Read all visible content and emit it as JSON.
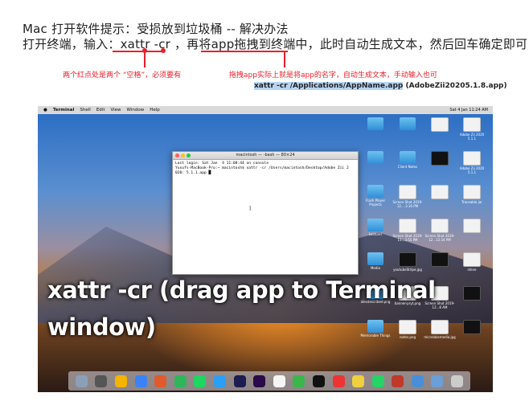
{
  "header": {
    "line1": "Mac 打开软件提示：受损放到垃圾桶 -- 解决办法",
    "line2_prefix": "打开终端，输入：",
    "line2_cmd": "xattr -cr ",
    "line2_mid": "，再将",
    "line2_drag": "app拖拽到终端中",
    "line2_suffix": "，此时自动生成文本，然后回车确定即可；"
  },
  "notes": {
    "left": "两个红点处是两个 “空格”，必须要有",
    "right": "拖拽app实际上就是将app的名字，自动生成文本，手动输入也可"
  },
  "path_example": {
    "selected": "xattr -cr /Applications/AppName.app",
    "rest": " (AdobeZii20205.1.8.app)"
  },
  "screenshot": {
    "menubar": {
      "apple": "",
      "app": "Terminal",
      "items": [
        "Shell",
        "Edit",
        "View",
        "Window",
        "Help"
      ],
      "clock": "Sat 4 Jan  11:24 AM"
    },
    "terminal": {
      "title": "macintosh — -bash — 80×24",
      "lines": [
        "Last login: Sat Jan  4 11:08:44 on console",
        "Yusufs-MacBook-Pro:~ macintosh$ xattr -cr /Users/macintosh/Desktop/Adobe Zii 2",
        "020: 5.1.1.app █"
      ]
    },
    "caption_line1": "xattr -cr (drag app to Terminal",
    "caption_line2": "window)",
    "desktop_icons": [
      "",
      "",
      "",
      "Adobe Zii 2020 5.1.1",
      "",
      "Client Notes",
      "",
      "Adobe Zii 2020 5.1.1",
      "Flash Player Projects",
      "Screen Shot 2019-12....3.16 PM",
      "",
      "Traceable jar",
      "Lecturer",
      "Screen Shot 2019-11...3.55 PM",
      "Screen Shot 2019-12...12.54 PM",
      "",
      "Media",
      "youtubeStripe.jpg",
      "",
      "steve",
      "alexdescribed.png",
      "banner-pryt.png",
      "Screen Shot 2019-12...8 AM",
      "",
      "Memorable Things",
      "notes.png",
      "microlabsmedia.jpg",
      ""
    ]
  },
  "colors": {
    "accent_red": "#e8202a",
    "selection": "#b7d5f3"
  }
}
